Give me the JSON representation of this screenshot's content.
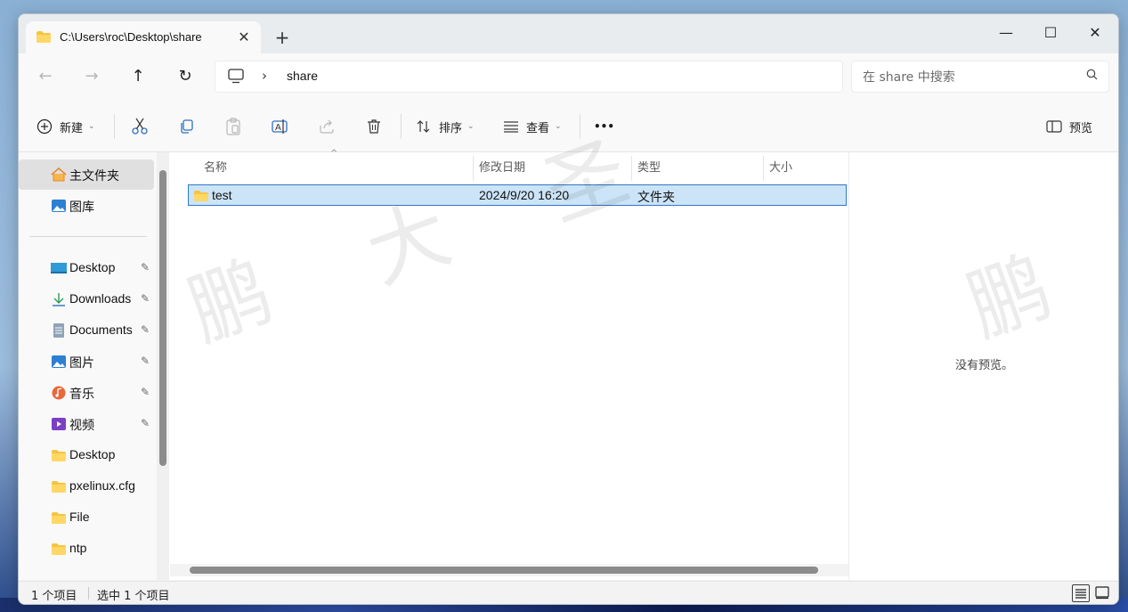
{
  "window": {
    "tab_title": "C:\\Users\\roc\\Desktop\\share",
    "tab_close": "✕",
    "new_tab": "+",
    "minimize": "—",
    "maximize": "☐",
    "close": "✕"
  },
  "nav": {
    "back": "←",
    "forward": "→",
    "up": "↑",
    "refresh": "↻",
    "chevron": "›",
    "crumb": "share"
  },
  "search": {
    "placeholder": "在 share 中搜索"
  },
  "toolbar": {
    "new_label": "新建",
    "sort_label": "排序",
    "view_label": "查看",
    "more": "•••",
    "preview_label": "预览"
  },
  "sidebar": {
    "items": [
      {
        "label": "主文件夹",
        "icon": "home-icon"
      },
      {
        "label": "图库",
        "icon": "gallery-icon"
      },
      {
        "label": "Desktop",
        "icon": "desktop-icon"
      },
      {
        "label": "Downloads",
        "icon": "download-icon"
      },
      {
        "label": "Documents",
        "icon": "documents-icon"
      },
      {
        "label": "图片",
        "icon": "pictures-icon"
      },
      {
        "label": "音乐",
        "icon": "music-icon"
      },
      {
        "label": "视频",
        "icon": "video-icon"
      },
      {
        "label": "Desktop",
        "icon": "folder-icon"
      },
      {
        "label": "pxelinux.cfg",
        "icon": "folder-icon"
      },
      {
        "label": "File",
        "icon": "folder-icon"
      },
      {
        "label": "ntp",
        "icon": "folder-icon"
      }
    ],
    "pin": "📌"
  },
  "columns": {
    "name": "名称",
    "modified": "修改日期",
    "type": "类型",
    "size": "大小"
  },
  "files": [
    {
      "name": "test",
      "modified": "2024/9/20 16:20",
      "type": "文件夹",
      "size": ""
    }
  ],
  "preview": {
    "message": "没有预览。"
  },
  "status": {
    "count": "1 个项目",
    "selected": "选中 1 个项目"
  },
  "colors": {
    "accent": "#2f78c9",
    "selection": "#cce4f7",
    "folder": "#f5c542"
  }
}
